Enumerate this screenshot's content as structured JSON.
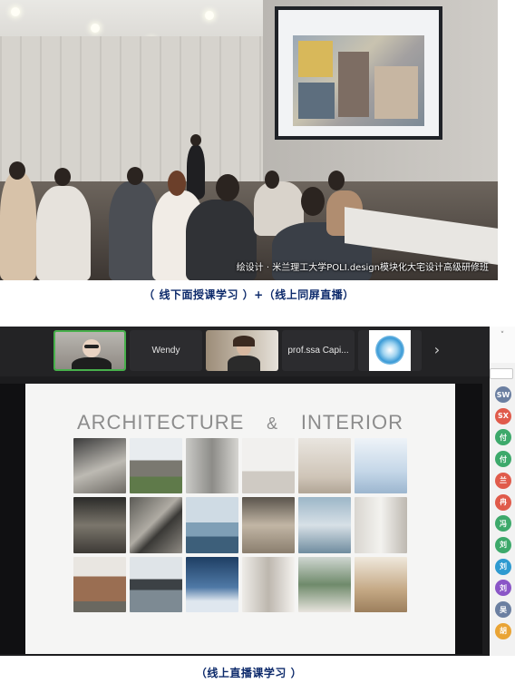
{
  "photo": {
    "overlay_caption": "绘设计 · 米兰理工大学POLI.design模块化大宅设计高级研修班"
  },
  "captions": {
    "offline": "（ 线下面授课学习 ）+（线上同屏直播）",
    "online": "（线上直播课学习 ）"
  },
  "call": {
    "participants": [
      {
        "name": "",
        "type": "video",
        "active": true
      },
      {
        "name": "Wendy",
        "type": "name"
      },
      {
        "name": "",
        "type": "video"
      },
      {
        "name": "prof.ssa Capi...",
        "type": "name"
      },
      {
        "name": "",
        "type": "logo"
      }
    ],
    "next_icon": "chevron-right-icon",
    "next_glyph": "›"
  },
  "slide": {
    "title_left": "ARCHITECTURE",
    "title_amp": "&",
    "title_right": "INTERIOR"
  },
  "sidebar": {
    "collapse_glyph": "˅",
    "avatars": [
      {
        "label": "SW",
        "color": "#6b7fa1"
      },
      {
        "label": "SX",
        "color": "#e05b4b"
      },
      {
        "label": "付",
        "color": "#3da96b"
      },
      {
        "label": "付",
        "color": "#3da96b"
      },
      {
        "label": "兰",
        "color": "#e05b4b"
      },
      {
        "label": "冉",
        "color": "#e05b4b"
      },
      {
        "label": "冯",
        "color": "#3da96b"
      },
      {
        "label": "刘",
        "color": "#3da96b"
      },
      {
        "label": "刘",
        "color": "#2e9ad0"
      },
      {
        "label": "刘",
        "color": "#8a56c7"
      },
      {
        "label": "吴",
        "color": "#6b7fa1"
      },
      {
        "label": "胡",
        "color": "#e9a435"
      }
    ]
  }
}
